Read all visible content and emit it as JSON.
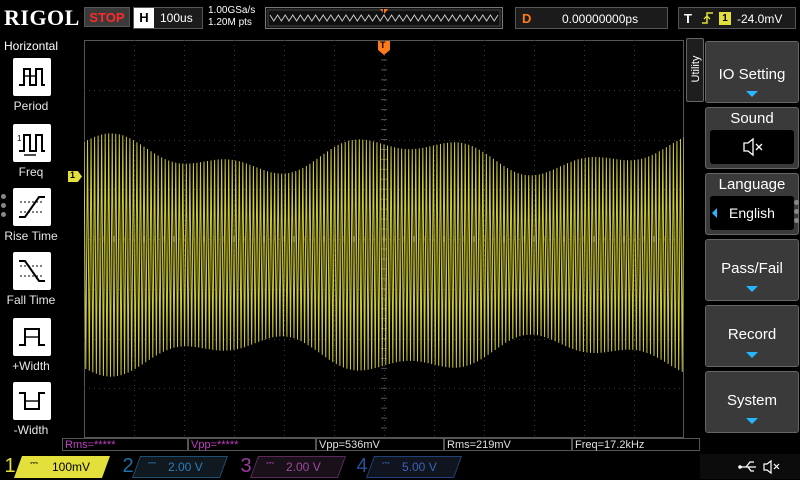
{
  "header": {
    "brand": "RIGOL",
    "run_state": "STOP",
    "timebase_label": "H",
    "timebase_value": "100us",
    "sample_rate": "1.00GSa/s",
    "memory_points": "1.20M pts",
    "memory_trigger_marker": "T",
    "delay_label": "D",
    "delay_value": "0.00000000ps",
    "trigger_label": "T",
    "trigger_edge": "rising",
    "trigger_source": "1",
    "trigger_level": "-24.0mV"
  },
  "left_panel": {
    "title": "Horizontal",
    "items": [
      {
        "label": "Period",
        "icon": "period-icon"
      },
      {
        "label": "Freq",
        "icon": "freq-icon"
      },
      {
        "label": "Rise Time",
        "icon": "rise-time-icon"
      },
      {
        "label": "Fall Time",
        "icon": "fall-time-icon"
      },
      {
        "label": "+Width",
        "icon": "positive-width-icon"
      },
      {
        "label": "-Width",
        "icon": "negative-width-icon"
      }
    ]
  },
  "scope": {
    "trigger_position_marker": "T",
    "channel1_marker": "1",
    "trigger_level_marker": "T",
    "trace_color": "#d8d53a",
    "waveform": "amplitude-modulated carrier"
  },
  "right_panel": {
    "menu_title": "Utility",
    "buttons": [
      {
        "label": "IO Setting",
        "has_submenu": true
      },
      {
        "label": "Sound",
        "value_icon": "speaker-muted-icon"
      },
      {
        "label": "Language",
        "value": "English"
      },
      {
        "label": "Pass/Fail",
        "has_submenu": true
      },
      {
        "label": "Record",
        "has_submenu": true
      },
      {
        "label": "System",
        "has_submenu": true
      }
    ]
  },
  "measurements": [
    {
      "text": "Rms=*****",
      "color": "#c040c0"
    },
    {
      "text": "Vpp=*****",
      "color": "#c040c0"
    },
    {
      "text": "Vpp=536mV",
      "color": "#e0e0e0"
    },
    {
      "text": "Rms=219mV",
      "color": "#e0e0e0"
    },
    {
      "text": "Freq=17.2kHz",
      "color": "#e0e0e0"
    }
  ],
  "channels": [
    {
      "number": "1",
      "scale": "100mV",
      "color": "#e4e03b",
      "active": true
    },
    {
      "number": "2",
      "scale": "2.00 V",
      "color": "#1e8fd6",
      "active": false
    },
    {
      "number": "3",
      "scale": "2.00 V",
      "color": "#c040c0",
      "active": false
    },
    {
      "number": "4",
      "scale": "5.00 V",
      "color": "#2060d0",
      "active": false
    }
  ],
  "status_icons": [
    "usb-icon",
    "speaker-muted-icon"
  ]
}
